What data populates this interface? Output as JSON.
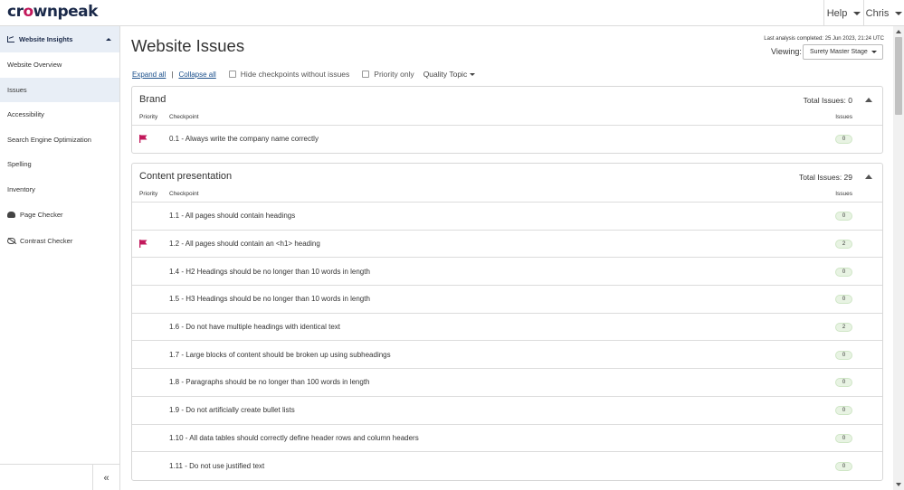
{
  "app": {
    "logo_text": "crownpeak"
  },
  "topbar": {
    "help_label": "Help",
    "user_label": "Chris"
  },
  "sidebar": {
    "header": {
      "label": "Website Insights",
      "icon": "chart-icon"
    },
    "items": [
      {
        "label": "Website Overview",
        "active": false
      },
      {
        "label": "Issues",
        "active": true
      },
      {
        "label": "Accessibility",
        "active": false
      },
      {
        "label": "Search Engine Optimization",
        "active": false
      },
      {
        "label": "Spelling",
        "active": false
      },
      {
        "label": "Inventory",
        "active": false
      }
    ],
    "tools": [
      {
        "label": "Page Checker",
        "icon": "cloud-icon"
      },
      {
        "label": "Contrast Checker",
        "icon": "eye-slash-icon"
      }
    ],
    "collapse_glyph": "«"
  },
  "main": {
    "title": "Website Issues",
    "analysis_text": "Last analysis completed: 25 Jun 2023, 21:24 UTC",
    "viewing_label": "Viewing:",
    "viewing_value": "Surety Master Stage",
    "controls": {
      "expand_all": "Expand all",
      "separator": "|",
      "collapse_all": "Collapse all",
      "hide_checkpoints": "Hide checkpoints without issues",
      "priority_only": "Priority only",
      "quality_topic": "Quality Topic"
    },
    "columns": {
      "priority": "Priority",
      "checkpoint": "Checkpoint",
      "issues": "Issues"
    },
    "colors": {
      "flag": "#c2185b",
      "active_bg": "#e8eef6",
      "badge_bg": "#e8f3e3"
    },
    "panels": [
      {
        "title": "Brand",
        "total": "Total Issues: 0",
        "rows": [
          {
            "checkpoint": "0.1 - Always write the company name correctly",
            "issues": "0",
            "priority": true
          }
        ]
      },
      {
        "title": "Content presentation",
        "total": "Total Issues: 29",
        "rows": [
          {
            "checkpoint": "1.1 - All pages should contain headings",
            "issues": "0",
            "priority": false
          },
          {
            "checkpoint": "1.2 - All pages should contain an <h1> heading",
            "issues": "2",
            "priority": true
          },
          {
            "checkpoint": "1.4 - H2 Headings should be no longer than 10 words in length",
            "issues": "0",
            "priority": false
          },
          {
            "checkpoint": "1.5 - H3 Headings should be no longer than 10 words in length",
            "issues": "0",
            "priority": false
          },
          {
            "checkpoint": "1.6 - Do not have multiple headings with identical text",
            "issues": "2",
            "priority": false
          },
          {
            "checkpoint": "1.7 - Large blocks of content should be broken up using subheadings",
            "issues": "0",
            "priority": false
          },
          {
            "checkpoint": "1.8 - Paragraphs should be no longer than 100 words in length",
            "issues": "0",
            "priority": false
          },
          {
            "checkpoint": "1.9 - Do not artificially create bullet lists",
            "issues": "0",
            "priority": false
          },
          {
            "checkpoint": "1.10 - All data tables should correctly define header rows and column headers",
            "issues": "0",
            "priority": false
          },
          {
            "checkpoint": "1.11 - Do not use justified text",
            "issues": "0",
            "priority": false
          }
        ]
      }
    ]
  }
}
